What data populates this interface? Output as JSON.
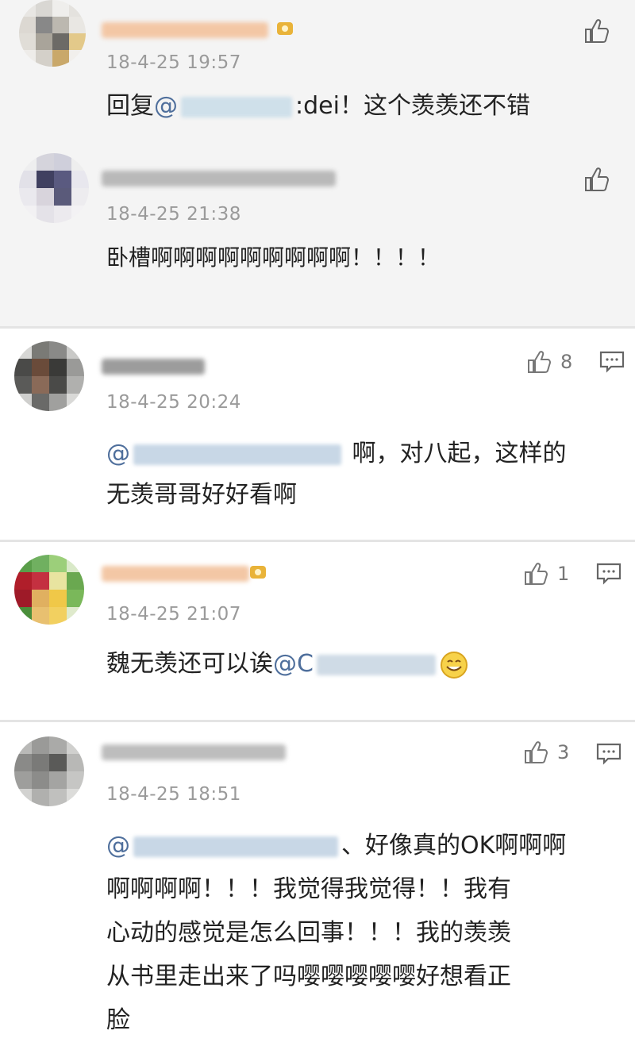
{
  "comments": [
    {
      "time": "18-4-25 19:57",
      "text_prefix": "回复",
      "mention_at": "@",
      "text_suffix": ":dei！这个羡羡还不错"
    },
    {
      "time": "18-4-25 21:38",
      "text": "卧槽啊啊啊啊啊啊啊啊啊！！！！"
    },
    {
      "time": "18-4-25 20:24",
      "like_count": "8",
      "mention_at": "@",
      "line1_suffix": "啊，对八起，这样的",
      "line2": "无羡哥哥好好看啊"
    },
    {
      "time": "18-4-25 21:07",
      "like_count": "1",
      "text_prefix": "魏无羡还可以诶",
      "mention_at": "@C"
    },
    {
      "time": "18-4-25 18:51",
      "like_count": "3",
      "mention_at": "@",
      "line1_suffix": "、好像真的OK啊啊啊",
      "line2": "啊啊啊啊！！！我觉得我觉得！！我有",
      "line3": "心动的感觉是怎么回事！！！我的羡羡",
      "line4": "从书里走出来了吗嘤嘤嘤嘤嘤好想看正",
      "line5": "脸"
    }
  ],
  "icons": {
    "like": "thumbs-up-icon",
    "reply": "comment-bubble-icon",
    "vip": "crown-badge-icon",
    "emoji": "smiley-emoji-icon"
  },
  "colors": {
    "mention": "#4f6f9c",
    "time": "#9a9a9a",
    "reply_bg": "#f4f4f4"
  }
}
